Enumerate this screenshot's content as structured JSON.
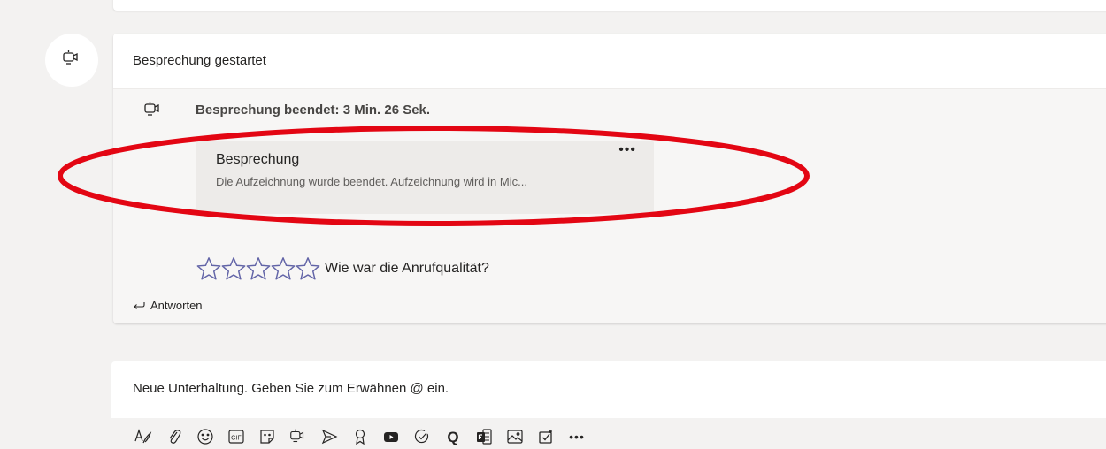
{
  "thread": {
    "title": "Besprechung gestartet",
    "ended_label": "Besprechung beendet: 3 Min. 26 Sek.",
    "meeting_card": {
      "title": "Besprechung",
      "description": "Die Aufzeichnung wurde beendet. Aufzeichnung wird in Mic...",
      "more_label": "•••"
    },
    "rating": {
      "question": "Wie war die Anrufqualität?",
      "stars": 5,
      "star_color": "#6264a7"
    },
    "reply_label": "Antworten"
  },
  "compose": {
    "placeholder": "Neue Unterhaltung. Geben Sie zum Erwähnen @ ein."
  },
  "toolbar": {
    "icons": [
      "format-icon",
      "attach-icon",
      "emoji-icon",
      "gif-icon",
      "sticker-icon",
      "meet-now-icon",
      "deliver-icon",
      "praise-icon",
      "youtube-icon",
      "approvals-icon",
      "q-icon",
      "forms-icon",
      "image-icon",
      "tasks-icon",
      "more-options-icon"
    ],
    "gif_label": "GIF",
    "q_label": "Q",
    "more_label": "•••"
  },
  "colors": {
    "background": "#f3f2f1",
    "card": "#ffffff",
    "highlight": "#e30613",
    "accent": "#6264a7"
  }
}
